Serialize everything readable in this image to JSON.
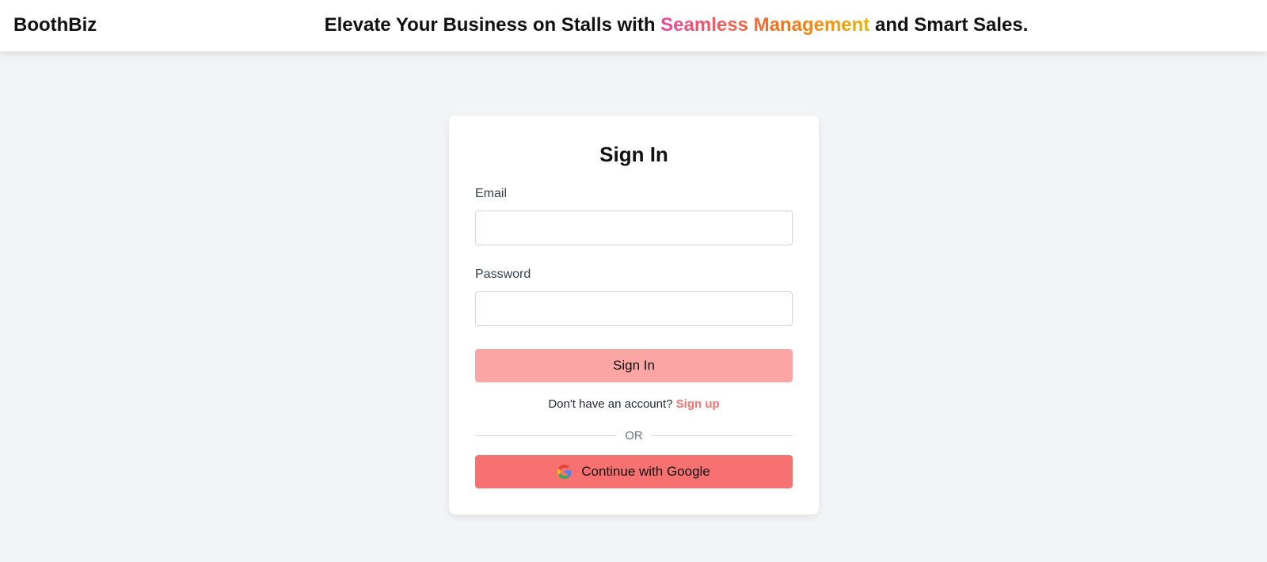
{
  "header": {
    "brand": "BoothBiz",
    "tagline_prefix": "Elevate Your Business on Stalls with ",
    "tagline_highlight": "Seamless Management",
    "tagline_suffix": " and Smart Sales."
  },
  "signin_card": {
    "title": "Sign In",
    "email_label": "Email",
    "email_value": "",
    "password_label": "Password",
    "password_value": "",
    "signin_button": "Sign In",
    "no_account_text": "Don't have an account? ",
    "signup_link": "Sign up",
    "divider_text": "OR",
    "google_button": "Continue with Google"
  },
  "icons": {
    "google": "google-icon"
  },
  "colors": {
    "page_background": "#f3f4f6",
    "signin_button": "#fca5a5",
    "google_button": "#f87171",
    "signup_link": "#f87171",
    "highlight_gradient": [
      "#ec4899",
      "#f97316",
      "#eab308"
    ]
  }
}
